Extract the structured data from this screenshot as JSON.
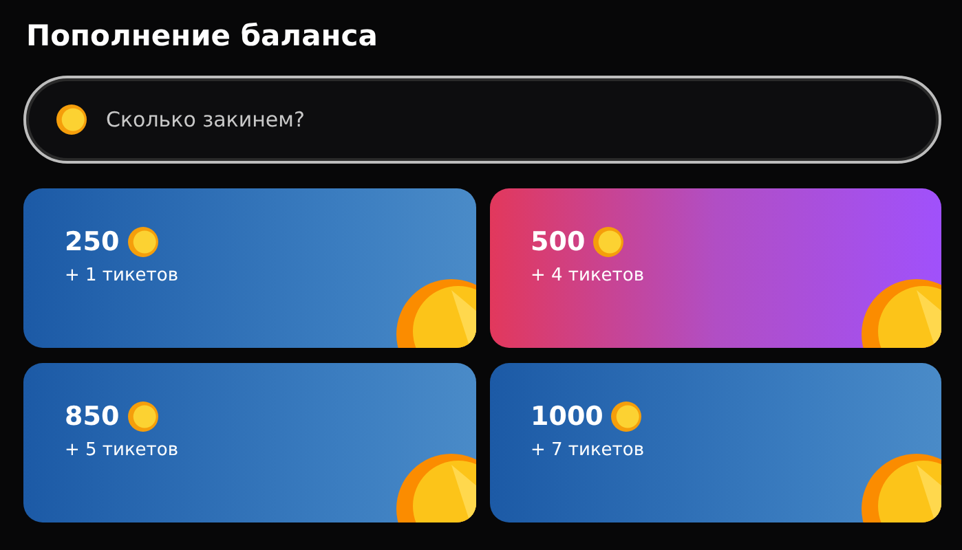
{
  "title": "Пополнение баланса",
  "amount_field": {
    "placeholder": "Сколько закинем?"
  },
  "packages": [
    {
      "amount": "250",
      "bonus": "+ 1 тикетов",
      "kind": "regular"
    },
    {
      "amount": "500",
      "bonus": "+ 4 тикетов",
      "kind": "featured"
    },
    {
      "amount": "850",
      "bonus": "+ 5 тикетов",
      "kind": "regular"
    },
    {
      "amount": "1000",
      "bonus": "+ 7 тикетов",
      "kind": "regular"
    }
  ]
}
